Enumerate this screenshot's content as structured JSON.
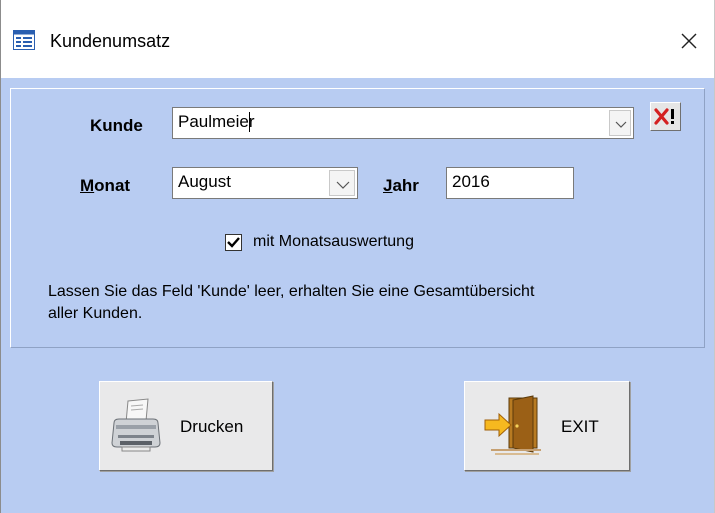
{
  "window": {
    "title": "Kundenumsatz",
    "icon": "form-icon",
    "close_symbol": "✕"
  },
  "form": {
    "kunde": {
      "label": "Kunde",
      "value": "Paulmeier"
    },
    "clear_button": {
      "icon": "delete-x-icon",
      "symbol": "!"
    },
    "monat": {
      "label": "Monat",
      "value": "August"
    },
    "jahr": {
      "label_first": "J",
      "label_rest": "ahr",
      "value": "2016"
    },
    "monatsauswertung": {
      "label": "mit Monatsauswertung",
      "checked": true
    },
    "hint_line1": "Lassen Sie das Feld 'Kunde' leer, erhalten Sie eine Gesamtübersicht",
    "hint_line2": "aller Kunden."
  },
  "buttons": {
    "drucken": {
      "label": "Drucken",
      "icon": "printer-icon"
    },
    "exit": {
      "label": "EXIT",
      "icon": "exit-door-icon"
    }
  },
  "colors": {
    "background": "#b8ccf2",
    "button_face": "#e9e9ea"
  }
}
